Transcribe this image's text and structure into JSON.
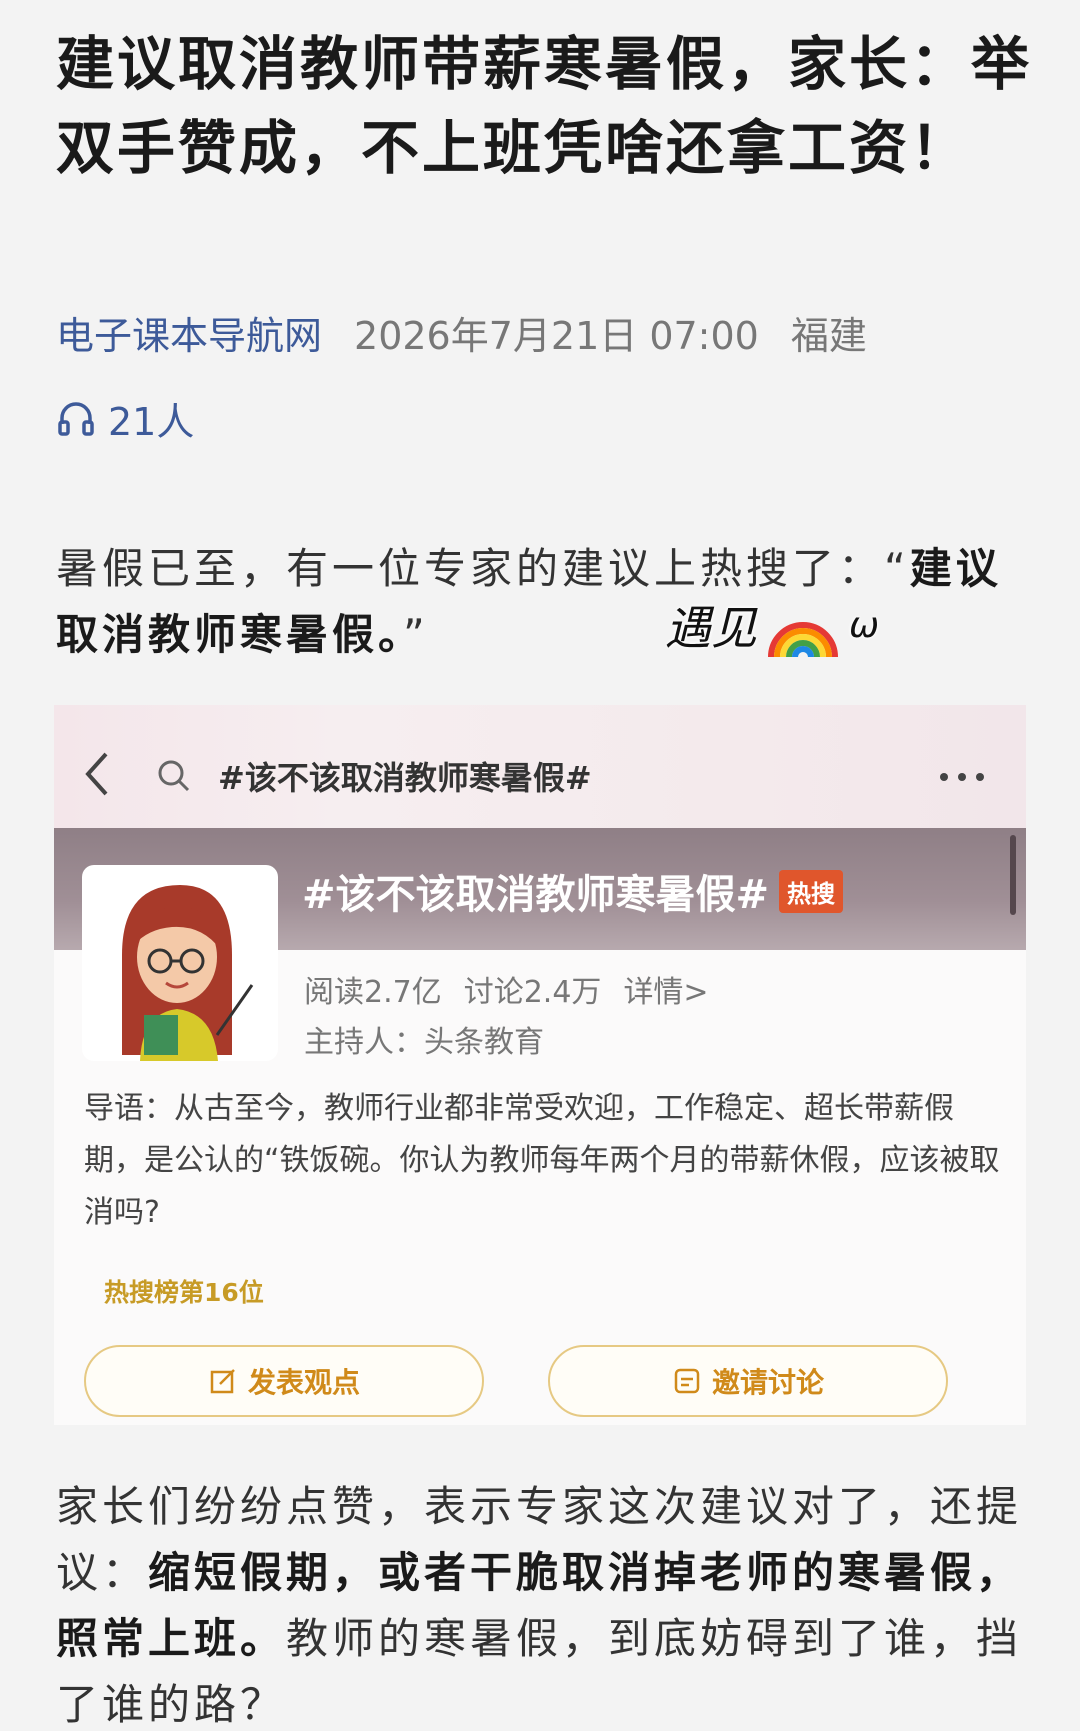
{
  "article": {
    "title": "建议取消教师带薪寒暑假，家长：举双手赞成，不上班凭啥还拿工资！",
    "source": "电子课本导航网",
    "date": "2026年7月21日 07:00",
    "location": "福建",
    "listeners": "21人",
    "para1_plain": "暑假已至，有一位专家的建议上热搜了：“",
    "para1_bold": "建议取消教师寒暑假。",
    "para1_end": "”",
    "para2_plain_1": "家长们纷纷点赞，表示专家这次建议对了，还提议：",
    "para2_bold": "缩短假期，或者干脆取消掉老师的寒暑假，照常上班。",
    "para2_plain_2": "教师的寒暑假，到底妨碍到了谁，挡了谁的路？"
  },
  "watermark": {
    "text": "遇见",
    "suffix": "ω"
  },
  "embedded_screenshot": {
    "search_text": "#该不该取消教师寒暑假#",
    "topic_title": "#该不该取消教师寒暑假#",
    "hot_badge": "热搜",
    "reads": "阅读2.7亿",
    "discussions": "讨论2.4万",
    "details": "详情>",
    "host": "主持人：头条教育",
    "intro": "导语：从古至今，教师行业都非常受欢迎，工作稳定、超长带薪假期，是公认的“铁饭碗。你认为教师每年两个月的带薪休假，应该被取消吗?",
    "rank": "热搜榜第16位",
    "btn_opinion": "发表观点",
    "btn_invite": "邀请讨论"
  },
  "colors": {
    "link": "#3d5a99",
    "accent": "#d08a1a",
    "hot": "#e0562c"
  }
}
